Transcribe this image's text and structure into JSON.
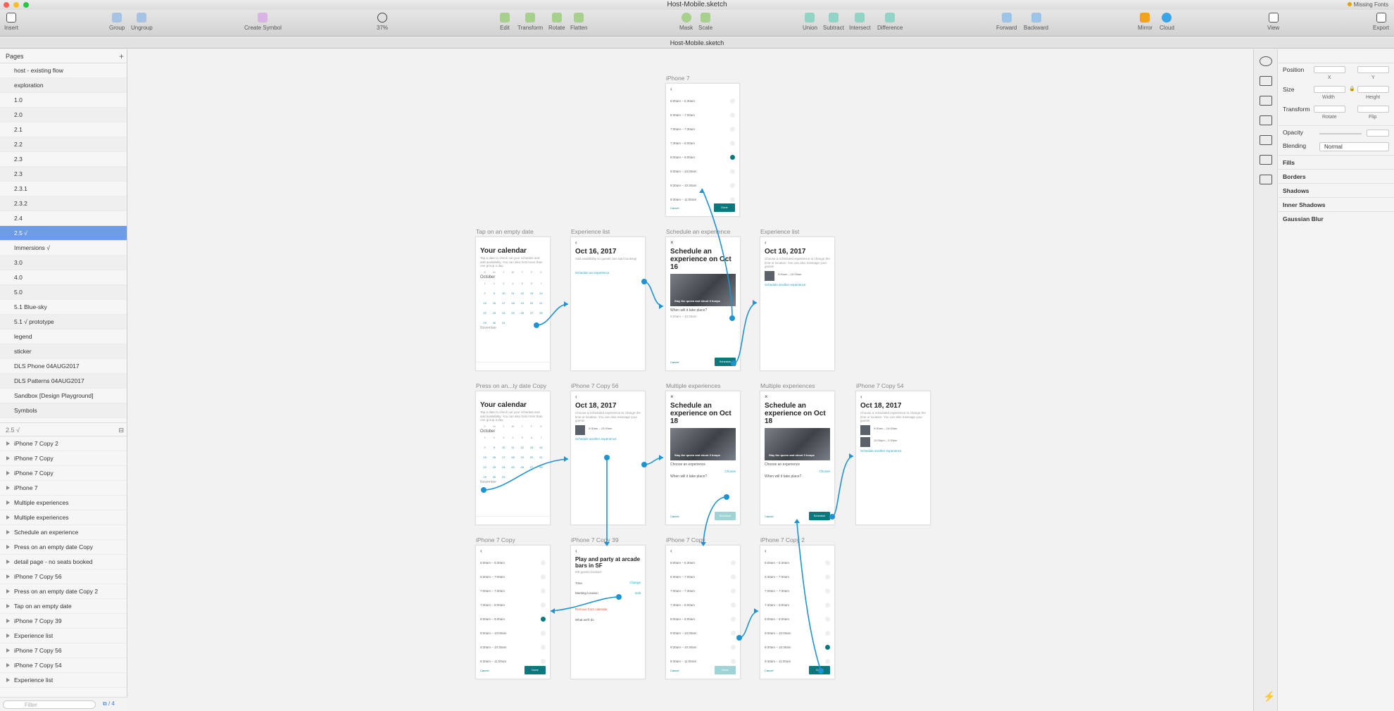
{
  "window": {
    "title": "Host-Mobile.sketch",
    "warning": "Missing Fonts",
    "doc_tab": "Host-Mobile.sketch"
  },
  "toolbar": {
    "insert": "Insert",
    "group": "Group",
    "ungroup": "Ungroup",
    "create_symbol": "Create Symbol",
    "zoom": "37%",
    "edit": "Edit",
    "transform": "Transform",
    "rotate": "Rotate",
    "flatten": "Flatten",
    "mask": "Mask",
    "scale": "Scale",
    "union": "Union",
    "subtract": "Subtract",
    "intersect": "Intersect",
    "difference": "Difference",
    "forward": "Forward",
    "backward": "Backward",
    "mirror": "Mirror",
    "cloud": "Cloud",
    "view": "View",
    "export": "Export"
  },
  "pages_header": "Pages",
  "pages": [
    "host - existing flow",
    "exploration",
    "1.0",
    "2.0",
    "2.1",
    "2.2",
    "2.3",
    "2.3",
    "2.3.1",
    "2.3.2",
    "2.4",
    "2.5 √",
    "Immersions √",
    "3.0",
    "4.0",
    "5.0",
    "5.1 Blue-sky",
    "5.1 √ prototype",
    "legend",
    "sticker",
    "DLS Phone 04AUG2017",
    "DLS Patterns 04AUG2017",
    "Sandbox [Design Playground]",
    "Symbols"
  ],
  "layers_header": "2.5 √",
  "layers": [
    "iPhone 7 Copy 2",
    "iPhone 7 Copy",
    "iPhone 7 Copy",
    "iPhone 7",
    "Multiple experiences",
    "Multiple experiences",
    "Schedule an experience",
    "Press on an empty date Copy",
    "detail page - no seats booked",
    "iPhone 7 Copy 56",
    "Press on an empty date Copy 2",
    "Tap on an empty date",
    "iPhone 7 Copy 39",
    "Experience list",
    "iPhone 7 Copy 56",
    "iPhone 7 Copy 54",
    "Experience list"
  ],
  "filter_placeholder": "Filter",
  "filter_count": "4",
  "artboards": {
    "iphone7": "iPhone 7",
    "tap_empty": "Tap on an empty date",
    "exp_list1": "Experience list",
    "schedule": "Schedule an experience",
    "exp_list2": "Experience list",
    "press_copy": "Press on an...ty date Copy",
    "copy56": "iPhone 7 Copy 56",
    "multi1": "Multiple experiences",
    "multi2": "Multiple experiences",
    "copy54": "iPhone 7 Copy 54",
    "copy": "iPhone 7 Copy",
    "copy39": "iPhone 7 Copy 39",
    "copy_b": "iPhone 7 Copy",
    "copy2": "iPhone 7 Copy 2"
  },
  "screen_text": {
    "your_calendar": "Your calendar",
    "cal_sub": "Tap a date to check out your schedule and add availability. You can also host more than one group a day.",
    "october": "October",
    "november": "November",
    "oct16": "Oct 16, 2017",
    "oct18": "Oct 18, 2017",
    "add_avail": "Add availability so guests can start booking!",
    "choose_sched": "Choose a scheduled experience to change the time or location. You can also message your guests",
    "schedule_exp": "Schedule an experience",
    "schedule_title_16": "Schedule an experience on Oct 16",
    "schedule_title_18": "Schedule an experience on Oct 18",
    "hero_text": "Slay the queen and shoot 3 hoops",
    "when": "When will it take place?",
    "choose_exp": "Choose an experience",
    "choose": "Choose",
    "schedule_btn": "Schedule",
    "cancel": "Cancel",
    "done": "Done",
    "schedule_another": "Schedule another experience",
    "slot_a": "9:00am – 10:00am",
    "slot_b": "12:00pm – 2:30pm",
    "booked": "0/6 guests booked",
    "play_title": "Play and party at arcade bars in SF",
    "time": "Time",
    "change": "Change",
    "meeting": "Meeting location",
    "edit": "Edit",
    "remove": "Remove from calendar",
    "what": "What we'll do"
  },
  "time_slots": [
    "6:00am – 6:30am",
    "6:30am – 7:00am",
    "7:00am – 7:30am",
    "7:30am – 8:00am",
    "8:00am – 9:00am",
    "9:00am – 10:00am",
    "9:30am – 10:30am",
    "9:30am – 11:00am"
  ],
  "weekdays": [
    "S",
    "M",
    "T",
    "W",
    "T",
    "F",
    "S"
  ],
  "inspector": {
    "position": "Position",
    "x": "X",
    "y": "Y",
    "size": "Size",
    "width": "Width",
    "height": "Height",
    "transform": "Transform",
    "rotate": "Rotate",
    "flip": "Flip",
    "opacity": "Opacity",
    "blending": "Blending",
    "blending_value": "Normal",
    "fills": "Fills",
    "borders": "Borders",
    "shadows": "Shadows",
    "inner_shadows": "Inner Shadows",
    "gaussian_blur": "Gaussian Blur"
  },
  "colors": {
    "accent": "#1f93d2",
    "teal": "#0a787d",
    "selection": "#6d9be6"
  }
}
